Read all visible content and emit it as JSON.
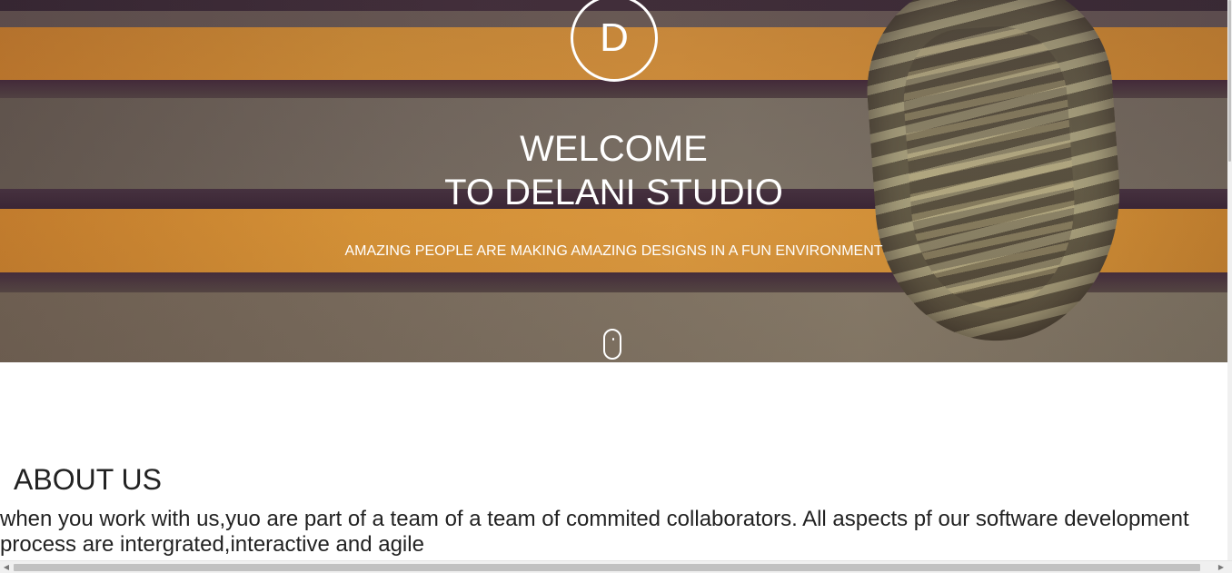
{
  "hero": {
    "logo_letter": "D",
    "title_line1": "WELCOME",
    "title_line2": "TO DELANI STUDIO",
    "subtitle": "AMAZING PEOPLE ARE MAKING AMAZING DESIGNS IN A FUN ENVIRONMENT",
    "scroll_icon": "mouse-scroll-icon"
  },
  "about": {
    "heading": "ABOUT US",
    "text": "when you work with us,yuo are part of a team of a team of commited collaborators. All aspects pf our software development process are intergrated,interactive and agile"
  },
  "scrollbars": {
    "left_arrow": "◀",
    "right_arrow": "▶"
  }
}
